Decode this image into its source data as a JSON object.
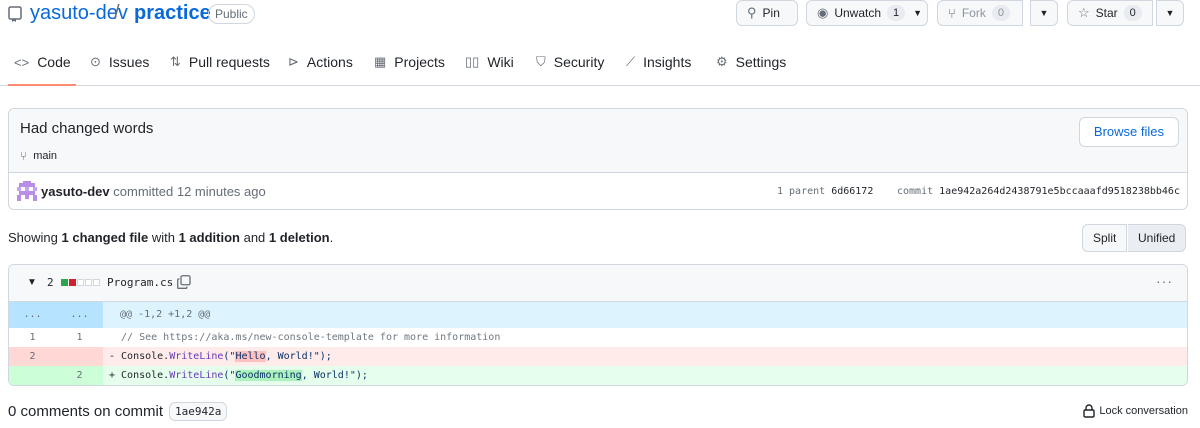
{
  "repo": {
    "owner": "yasuto-dev",
    "separator": "/",
    "name": "practice",
    "visibility": "Public"
  },
  "actions": {
    "pin": "Pin",
    "unwatch": "Unwatch",
    "unwatch_count": "1",
    "fork": "Fork",
    "fork_count": "0",
    "star": "Star",
    "star_count": "0"
  },
  "tabs": [
    {
      "label": "Code",
      "icon": "code-icon"
    },
    {
      "label": "Issues",
      "icon": "issue-icon"
    },
    {
      "label": "Pull requests",
      "icon": "pull-request-icon"
    },
    {
      "label": "Actions",
      "icon": "play-icon"
    },
    {
      "label": "Projects",
      "icon": "table-icon"
    },
    {
      "label": "Wiki",
      "icon": "book-icon"
    },
    {
      "label": "Security",
      "icon": "shield-icon"
    },
    {
      "label": "Insights",
      "icon": "graph-icon"
    },
    {
      "label": "Settings",
      "icon": "gear-icon"
    }
  ],
  "commit": {
    "title": "Had changed words",
    "branch": "main",
    "browse_label": "Browse files",
    "author": "yasuto-dev",
    "committed_text": "committed 12 minutes ago",
    "parent_label": "1 parent",
    "parent_sha": "6d66172",
    "commit_label": "commit",
    "commit_sha": "1ae942a264d2438791e5bccaaafd9518238bb46c"
  },
  "summary": {
    "showing": "Showing",
    "files": "1 changed file",
    "with": "with",
    "additions": "1 addition",
    "and": "and",
    "deletions": "1 deletion",
    "period": ".",
    "split_label": "Split",
    "unified_label": "Unified"
  },
  "file": {
    "changes": "2",
    "name": "Program.cs",
    "more": "···",
    "hunk_left": "...",
    "hunk_right": "...",
    "hunk_header": "@@ -1,2 +1,2 @@",
    "lines": {
      "ctx_old": "1",
      "ctx_new": "1",
      "ctx_code": "  // See https://aka.ms/new-console-template for more information",
      "del_old": "2",
      "del_prefix": "- Console.",
      "del_fn": "WriteLine",
      "del_open": "(\"",
      "del_hl": "Hello",
      "del_rest": ", World!\");",
      "add_new": "2",
      "add_prefix": "+ Console.",
      "add_fn": "WriteLine",
      "add_open": "(\"",
      "add_hl": "Goodmorning",
      "add_rest": ", World!\");"
    }
  },
  "comments": {
    "label": "0 comments on commit",
    "sha": "1ae942a",
    "lock_label": "Lock conversation"
  },
  "colors": {
    "link": "#0969da",
    "deletion": "#cf222e",
    "addition": "#2da44e",
    "active_tab": "#fd8c73"
  }
}
